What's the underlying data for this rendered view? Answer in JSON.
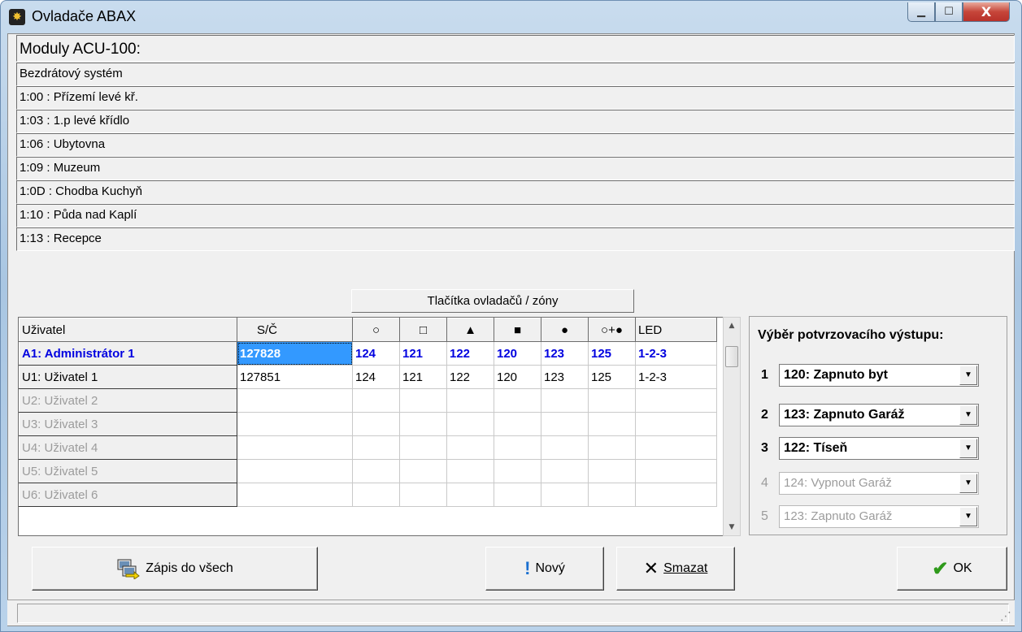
{
  "window": {
    "title": "Ovladače ABAX",
    "controls": {
      "minimize": "▁",
      "maximize": "☐",
      "close": "X"
    }
  },
  "modules": {
    "heading": "Moduly ACU-100:",
    "items": [
      "Bezdrátový systém",
      "1:00 :  Přízemí levé kř.",
      "1:03 :  1.p levé křídlo",
      "1:06 :  Ubytovna",
      "1:09 :  Muzeum",
      "1:0D :  Chodba Kuchyň",
      "1:10 :  Půda nad Kaplí",
      "1:13 :  Recepce"
    ]
  },
  "grid": {
    "group_header": "Tlačítka ovladačů / zóny",
    "columns": [
      "Uživatel",
      "S/Č",
      "○",
      "□",
      "▲",
      "■",
      "●",
      "○+●",
      "LED"
    ],
    "rows": [
      {
        "user": "A1: Administrátor 1",
        "sn": "127828",
        "b1": "124",
        "b2": "121",
        "b3": "122",
        "b4": "120",
        "b5": "123",
        "b6": "125",
        "led": "1-2-3"
      },
      {
        "user": "U1: Uživatel  1",
        "sn": "127851",
        "b1": "124",
        "b2": "121",
        "b3": "122",
        "b4": "120",
        "b5": "123",
        "b6": "125",
        "led": "1-2-3"
      },
      {
        "user": "U2: Uživatel  2",
        "sn": "",
        "b1": "",
        "b2": "",
        "b3": "",
        "b4": "",
        "b5": "",
        "b6": "",
        "led": ""
      },
      {
        "user": "U3: Uživatel  3",
        "sn": "",
        "b1": "",
        "b2": "",
        "b3": "",
        "b4": "",
        "b5": "",
        "b6": "",
        "led": ""
      },
      {
        "user": "U4: Uživatel  4",
        "sn": "",
        "b1": "",
        "b2": "",
        "b3": "",
        "b4": "",
        "b5": "",
        "b6": "",
        "led": ""
      },
      {
        "user": "U5: Uživatel  5",
        "sn": "",
        "b1": "",
        "b2": "",
        "b3": "",
        "b4": "",
        "b5": "",
        "b6": "",
        "led": ""
      },
      {
        "user": "U6: Uživatel  6",
        "sn": "",
        "b1": "",
        "b2": "",
        "b3": "",
        "b4": "",
        "b5": "",
        "b6": "",
        "led": ""
      }
    ]
  },
  "confirm_panel": {
    "title": "Výběr potvrzovacího výstupu:",
    "outputs": [
      {
        "num": "1",
        "value": "120: Zapnuto byt",
        "enabled": true
      },
      {
        "num": "2",
        "value": "123: Zapnuto Garáž",
        "enabled": true
      },
      {
        "num": "3",
        "value": "122: Tíseň",
        "enabled": true
      },
      {
        "num": "4",
        "value": "124: Vypnout Garáž",
        "enabled": false
      },
      {
        "num": "5",
        "value": "123: Zapnuto Garáž",
        "enabled": false
      }
    ]
  },
  "buttons": {
    "write_all": "Zápis do všech",
    "new": "Nový",
    "delete": "Smazat",
    "ok": "OK"
  },
  "colors": {
    "accent_blue": "#0000e0",
    "selection": "#3399ff",
    "disabled": "#9c9c9c"
  }
}
